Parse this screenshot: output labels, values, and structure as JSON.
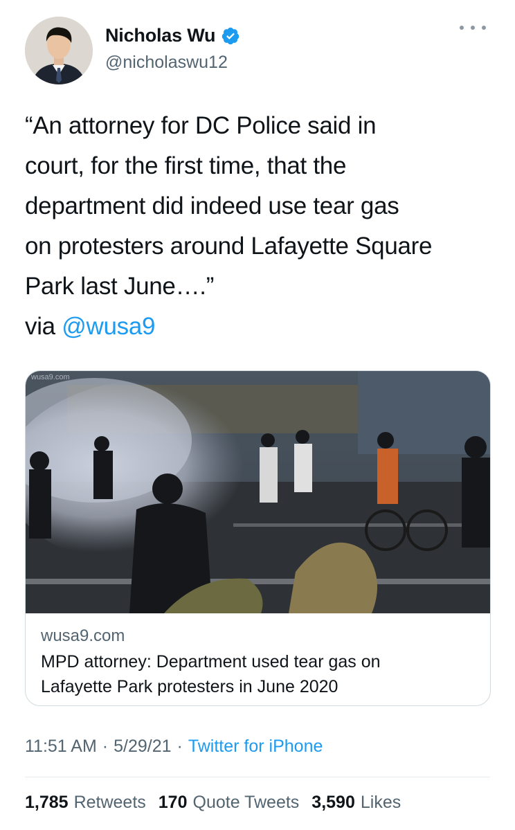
{
  "author": {
    "display_name": "Nicholas Wu",
    "handle": "@nicholaswu12",
    "verified": true
  },
  "icons": {
    "verified": "verified-badge-icon",
    "more": "more-options-icon"
  },
  "tweet": {
    "lines": [
      "“An attorney for DC Police said in",
      "court, for the first time, that the",
      "department did indeed use tear gas",
      "on protesters around Lafayette Square",
      "Park last June….”"
    ],
    "via_prefix": "via",
    "via_mention": "@wusa9"
  },
  "card": {
    "watermark": "wusa9.com",
    "domain": "wusa9.com",
    "title_line1": "MPD attorney: Department used tear gas on",
    "title_line2": "Lafayette Park protesters in June 2020"
  },
  "meta": {
    "time": "11:51 AM",
    "separator1": "·",
    "date": "5/29/21",
    "separator2": "·",
    "source": "Twitter for iPhone"
  },
  "stats": {
    "retweets_count": "1,785",
    "retweets_label": "Retweets",
    "quotes_count": "170",
    "quotes_label": "Quote Tweets",
    "likes_count": "3,590",
    "likes_label": "Likes"
  },
  "colors": {
    "accent": "#1d9bf0",
    "secondary_text": "#536471",
    "primary_text": "#0f1419"
  }
}
